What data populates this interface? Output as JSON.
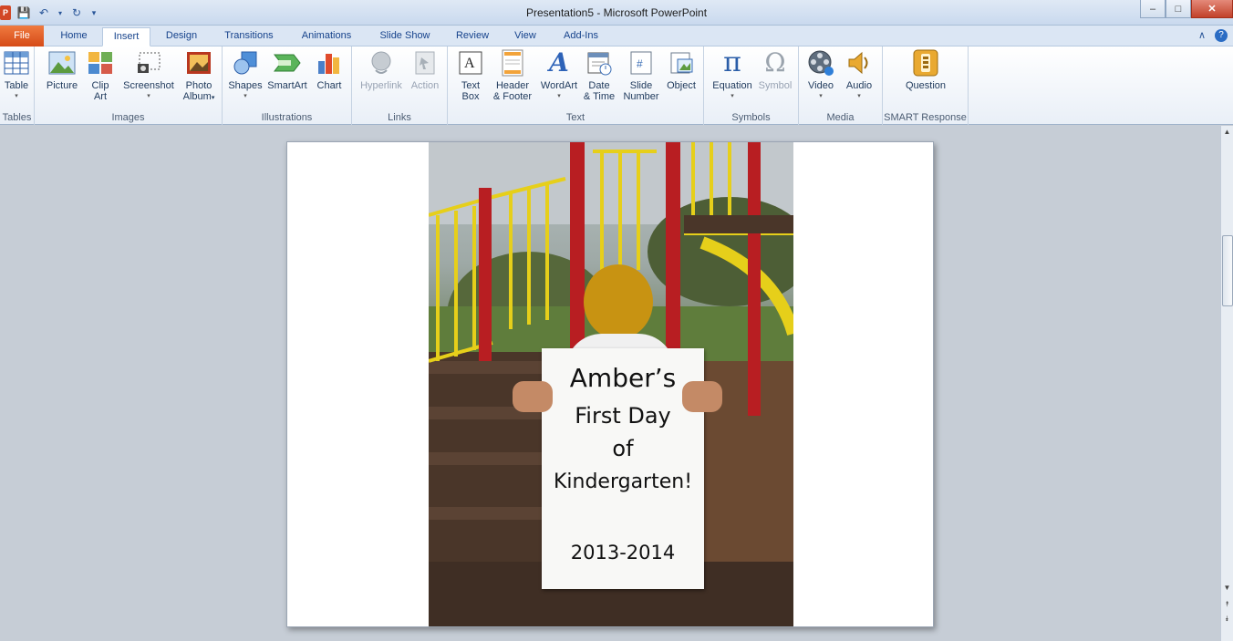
{
  "window": {
    "title": "Presentation5  -  Microsoft PowerPoint",
    "minimize": "–",
    "maximize": "□",
    "close": "✕",
    "logo": "P"
  },
  "qat": {
    "save": "💾",
    "undo": "↶",
    "undo_drop": "▾",
    "redo": "↻",
    "customize": "▾"
  },
  "tabs": [
    {
      "label": "File"
    },
    {
      "label": "Home"
    },
    {
      "label": "Insert"
    },
    {
      "label": "Design"
    },
    {
      "label": "Transitions"
    },
    {
      "label": "Animations"
    },
    {
      "label": "Slide Show"
    },
    {
      "label": "Review"
    },
    {
      "label": "View"
    },
    {
      "label": "Add-Ins"
    }
  ],
  "ribbon_right": {
    "collapse": "∧",
    "help": "?"
  },
  "ribbon": {
    "groups": {
      "tables": "Tables",
      "images": "Images",
      "illustrations": "Illustrations",
      "links": "Links",
      "text": "Text",
      "symbols": "Symbols",
      "media": "Media",
      "smart": "SMART Response"
    },
    "buttons": {
      "table": "Table",
      "picture": "Picture",
      "clipart_1": "Clip",
      "clipart_2": "Art",
      "screenshot": "Screenshot",
      "photo_1": "Photo",
      "photo_2": "Album",
      "shapes": "Shapes",
      "smartart": "SmartArt",
      "chart": "Chart",
      "hyperlink": "Hyperlink",
      "action": "Action",
      "textbox_1": "Text",
      "textbox_2": "Box",
      "header_1": "Header",
      "header_2": "& Footer",
      "wordart": "WordArt",
      "date_1": "Date",
      "date_2": "& Time",
      "slide_1": "Slide",
      "slide_2": "Number",
      "object": "Object",
      "equation": "Equation",
      "symbol": "Symbol",
      "video": "Video",
      "audio": "Audio",
      "question": "Question",
      "drop": "▾"
    },
    "icons": {
      "pi": "π",
      "omega": "Ω",
      "wordart_a": "A"
    }
  },
  "slide": {
    "poster": {
      "line1": "Amber’s",
      "line2": "First Day",
      "line3": "of",
      "line4": "Kindergarten!",
      "line5": "2013-2014"
    }
  },
  "scroll": {
    "up": "▲",
    "down": "▼",
    "prev": "⯭",
    "next": "⯯"
  }
}
